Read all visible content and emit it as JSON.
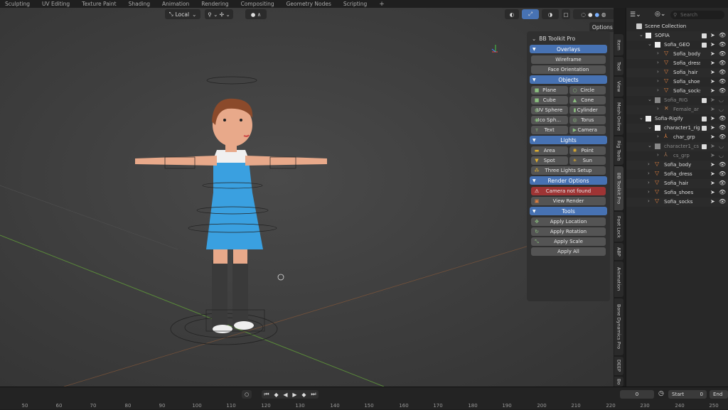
{
  "workspaces": [
    "Sculpting",
    "UV Editing",
    "Texture Paint",
    "Shading",
    "Animation",
    "Rendering",
    "Compositing",
    "Geometry Nodes",
    "Scripting"
  ],
  "workspace_add": "+",
  "viewport": {
    "transform_orientation": "Local",
    "options_label": "Options"
  },
  "toolkit": {
    "title": "BB Toolkit Pro",
    "sections": {
      "overlays": "Overlays",
      "objects": "Objects",
      "lights": "Lights",
      "render": "Render Options",
      "tools": "Tools"
    },
    "overlays": {
      "wireframe": "Wireframe",
      "face_orientation": "Face Orientation"
    },
    "objects": {
      "plane": "Plane",
      "circle": "Circle",
      "cube": "Cube",
      "cone": "Cone",
      "uv_sphere": "UV Sphere",
      "cylinder": "Cylinder",
      "ico_sphere": "Ico Sph...",
      "torus": "Torus",
      "text": "Text",
      "camera": "Camera"
    },
    "lights": {
      "area": "Area",
      "point": "Point",
      "spot": "Spot",
      "sun": "Sun",
      "three_lights": "Three Lights Setup"
    },
    "render": {
      "camera_status": "Camera not found",
      "view_render": "View Render"
    },
    "tools": {
      "apply_location": "Apply Location",
      "apply_rotation": "Apply Rotation",
      "apply_scale": "Apply Scale",
      "apply_all": "Apply All"
    }
  },
  "side_tabs": [
    "Item",
    "Tool",
    "View",
    "Mesh Online",
    "Rig Tools",
    "BB Toolkit Pro",
    "Foot Lock",
    "ABP",
    "Animation",
    "Bone Dynamics Pro",
    "DEEP",
    "Bo"
  ],
  "outliner": {
    "search_placeholder": "Search",
    "rows": [
      {
        "label": "Scene Collection"
      },
      {
        "label": "SOFIA"
      },
      {
        "label": "Sofia_GEO"
      },
      {
        "label": "Sofia_body"
      },
      {
        "label": "Sofia_dress"
      },
      {
        "label": "Sofia_hair"
      },
      {
        "label": "Sofia_shoes"
      },
      {
        "label": "Sofia_socks"
      },
      {
        "label": "Sofia_RIG"
      },
      {
        "label": "Female_ar"
      },
      {
        "label": "Sofia-Rigify"
      },
      {
        "label": "character1_rig"
      },
      {
        "label": "char_grp"
      },
      {
        "label": "character1_cs"
      },
      {
        "label": "cs_grp"
      },
      {
        "label": "Sofia_body"
      },
      {
        "label": "Sofia_dress"
      },
      {
        "label": "Sofia_hair"
      },
      {
        "label": "Sofia_shoes"
      },
      {
        "label": "Sofia_socks"
      }
    ]
  },
  "timeline": {
    "current_frame": "0",
    "start_label": "Start",
    "start_value": "0",
    "end_label": "End",
    "ticks": [
      "50",
      "60",
      "70",
      "80",
      "90",
      "100",
      "110",
      "120",
      "130",
      "140",
      "150",
      "160",
      "170",
      "180",
      "190",
      "200",
      "210",
      "220",
      "230",
      "240",
      "250"
    ]
  },
  "colors": {
    "accent": "#4772b3",
    "warning": "#9e3434",
    "dress": "#3aa0e0",
    "hair": "#8b4a2b",
    "skin": "#e8a98a"
  }
}
